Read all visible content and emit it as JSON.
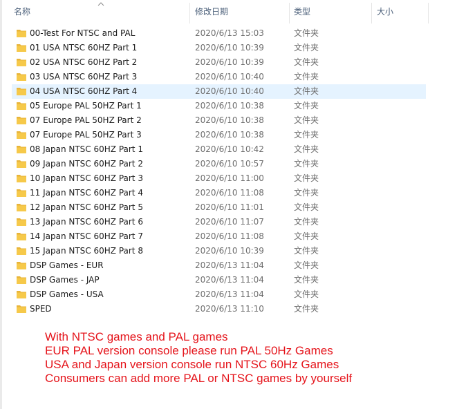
{
  "columns": {
    "name": "名称",
    "modified": "修改日期",
    "type": "类型",
    "size": "大小"
  },
  "rows": [
    {
      "name": "00-Test For NTSC and PAL",
      "date": "2020/6/13 15:03",
      "type": "文件夹"
    },
    {
      "name": "01 USA NTSC 60HZ Part 1",
      "date": "2020/6/10 10:39",
      "type": "文件夹"
    },
    {
      "name": "02 USA NTSC 60HZ Part 2",
      "date": "2020/6/10 10:39",
      "type": "文件夹"
    },
    {
      "name": "03 USA NTSC 60HZ Part 3",
      "date": "2020/6/10 10:40",
      "type": "文件夹"
    },
    {
      "name": "04 USA NTSC 60HZ Part 4",
      "date": "2020/6/10 10:40",
      "type": "文件夹"
    },
    {
      "name": "05 Europe PAL 50HZ Part 1",
      "date": "2020/6/10 10:38",
      "type": "文件夹"
    },
    {
      "name": "07 Europe PAL 50HZ Part 2",
      "date": "2020/6/10 10:38",
      "type": "文件夹"
    },
    {
      "name": "07 Europe PAL 50HZ Part 3",
      "date": "2020/6/10 10:38",
      "type": "文件夹"
    },
    {
      "name": "08 Japan NTSC 60HZ Part 1",
      "date": "2020/6/10 10:42",
      "type": "文件夹"
    },
    {
      "name": "09 Japan NTSC 60HZ Part 2",
      "date": "2020/6/10 10:57",
      "type": "文件夹"
    },
    {
      "name": "10 Japan NTSC 60HZ Part 3",
      "date": "2020/6/10 11:00",
      "type": "文件夹"
    },
    {
      "name": "11 Japan NTSC 60HZ Part 4",
      "date": "2020/6/10 11:08",
      "type": "文件夹"
    },
    {
      "name": "12 Japan NTSC 60HZ Part 5",
      "date": "2020/6/10 11:01",
      "type": "文件夹"
    },
    {
      "name": "13 Japan NTSC 60HZ Part 6",
      "date": "2020/6/10 11:07",
      "type": "文件夹"
    },
    {
      "name": "14 Japan NTSC 60HZ Part 7",
      "date": "2020/6/10 11:08",
      "type": "文件夹"
    },
    {
      "name": "15 Japan NTSC 60HZ Part 8",
      "date": "2020/6/10 10:39",
      "type": "文件夹"
    },
    {
      "name": "DSP Games - EUR",
      "date": "2020/6/13 11:04",
      "type": "文件夹"
    },
    {
      "name": "DSP Games - JAP",
      "date": "2020/6/13 11:04",
      "type": "文件夹"
    },
    {
      "name": "DSP Games - USA",
      "date": "2020/6/13 11:04",
      "type": "文件夹"
    },
    {
      "name": "SPED",
      "date": "2020/6/13 11:10",
      "type": "文件夹"
    }
  ],
  "selected_row": "04 USA NTSC 60HZ Part 4",
  "note": {
    "lines": [
      "With NTSC games and PAL games",
      "EUR PAL version console please run PAL 50Hz Games",
      "USA and Japan version console run NTSC 60Hz Games",
      "Consumers can add more PAL or NTSC games by yourself"
    ],
    "color": "#e5141b"
  },
  "colors": {
    "selection": "#e5f3ff",
    "folder": "#f6c94a",
    "header_text": "#4c607a"
  },
  "icons": {
    "folder": "folder-icon",
    "sort": "sort-ascending-icon"
  }
}
